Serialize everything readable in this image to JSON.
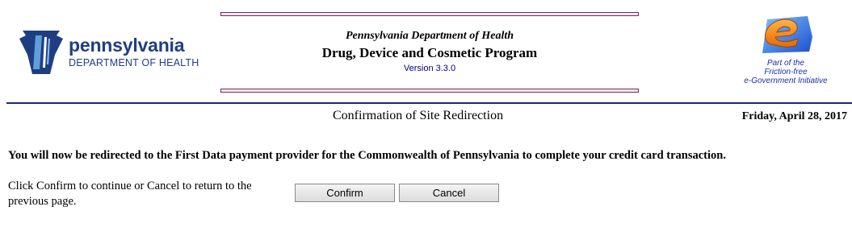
{
  "header": {
    "pa_logo": {
      "wordmark": "pennsylvania",
      "subtitle": "DEPARTMENT OF HEALTH",
      "icon": "keystone-icon"
    },
    "title_line1": "Pennsylvania Department of Health",
    "title_line2": "Drug, Device and Cosmetic Program",
    "version": "Version 3.3.0",
    "egov": {
      "icon": "e-logo-icon",
      "line1": "Part of the",
      "line2": "Friction-free",
      "line3": "e-Government Initiative"
    }
  },
  "page": {
    "title": "Confirmation of Site Redirection",
    "date": "Friday, April 28, 2017",
    "message": "You will now be redirected to the First Data payment provider for the Commonwealth of Pennsylvania to complete your credit card transaction.",
    "instructions": "Click Confirm to continue or Cancel to return to the previous page."
  },
  "buttons": {
    "confirm": "Confirm",
    "cancel": "Cancel"
  },
  "colors": {
    "pa_blue": "#1f3e82",
    "title_bar_border": "#7a2a5c",
    "divider": "#1a2a6c",
    "version_text": "#000080"
  }
}
